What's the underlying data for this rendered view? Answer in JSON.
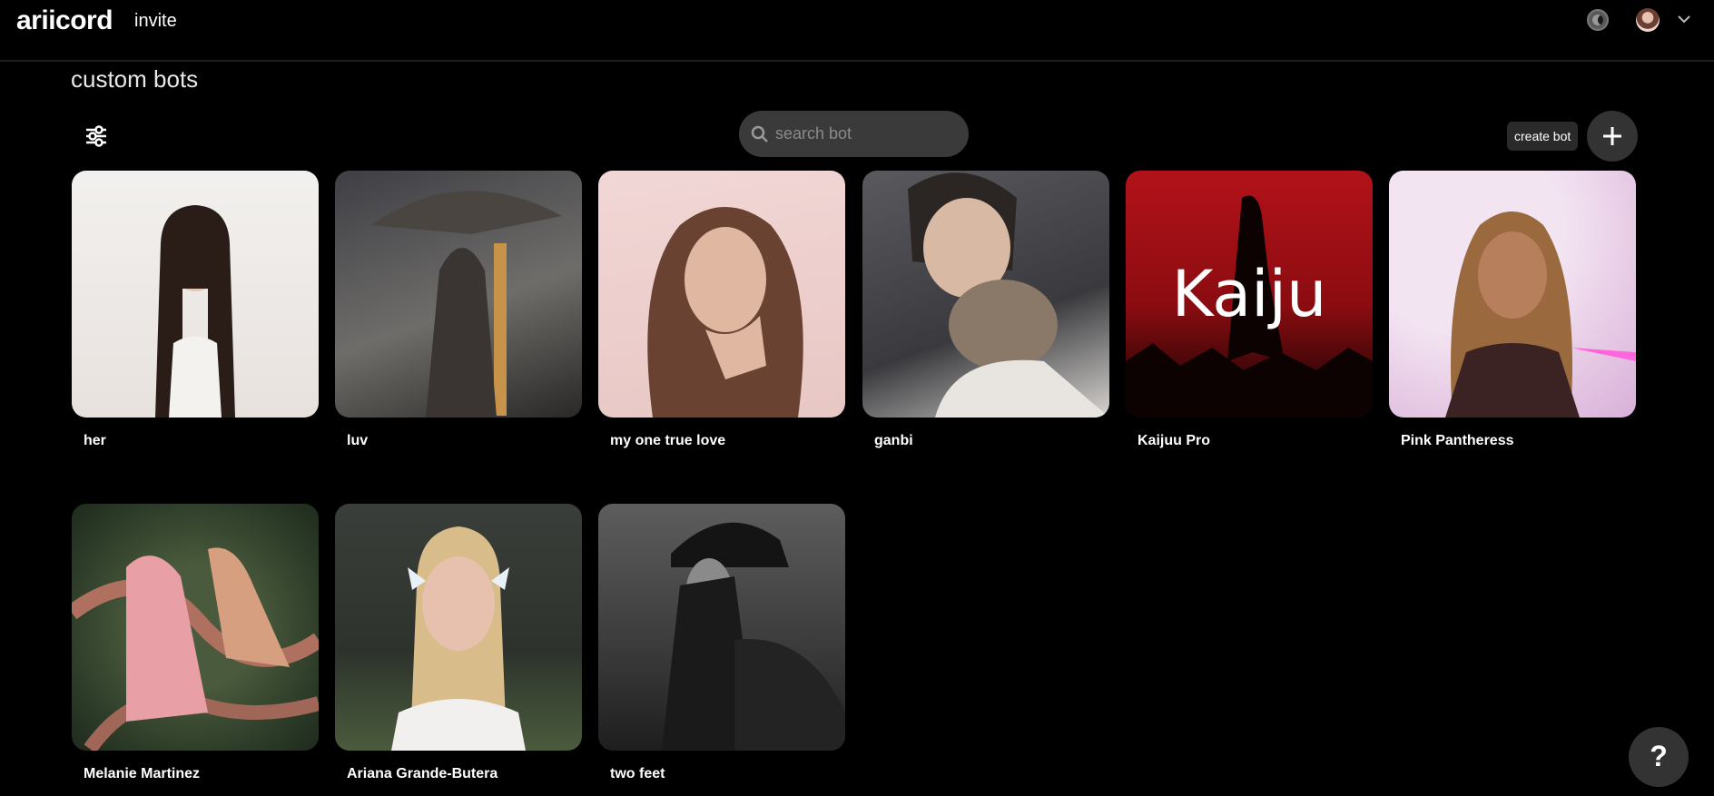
{
  "header": {
    "logo": "ariicord",
    "invite_label": "invite"
  },
  "page": {
    "title": "custom bots"
  },
  "toolbar": {
    "search_placeholder": "search bot",
    "create_label": "create bot"
  },
  "bots": [
    {
      "name": "her"
    },
    {
      "name": "luv"
    },
    {
      "name": "my one true love"
    },
    {
      "name": "ganbi"
    },
    {
      "name": "Kaijuu Pro",
      "image_text": "Kaiju"
    },
    {
      "name": "Pink Pantheress"
    },
    {
      "name": "Melanie Martinez"
    },
    {
      "name": "Ariana Grande-Butera"
    },
    {
      "name": "two feet"
    }
  ],
  "help": {
    "label": "?"
  },
  "colors": {
    "background": "#000000",
    "search_bg": "#3a3a3a",
    "button_bg": "#333333"
  }
}
